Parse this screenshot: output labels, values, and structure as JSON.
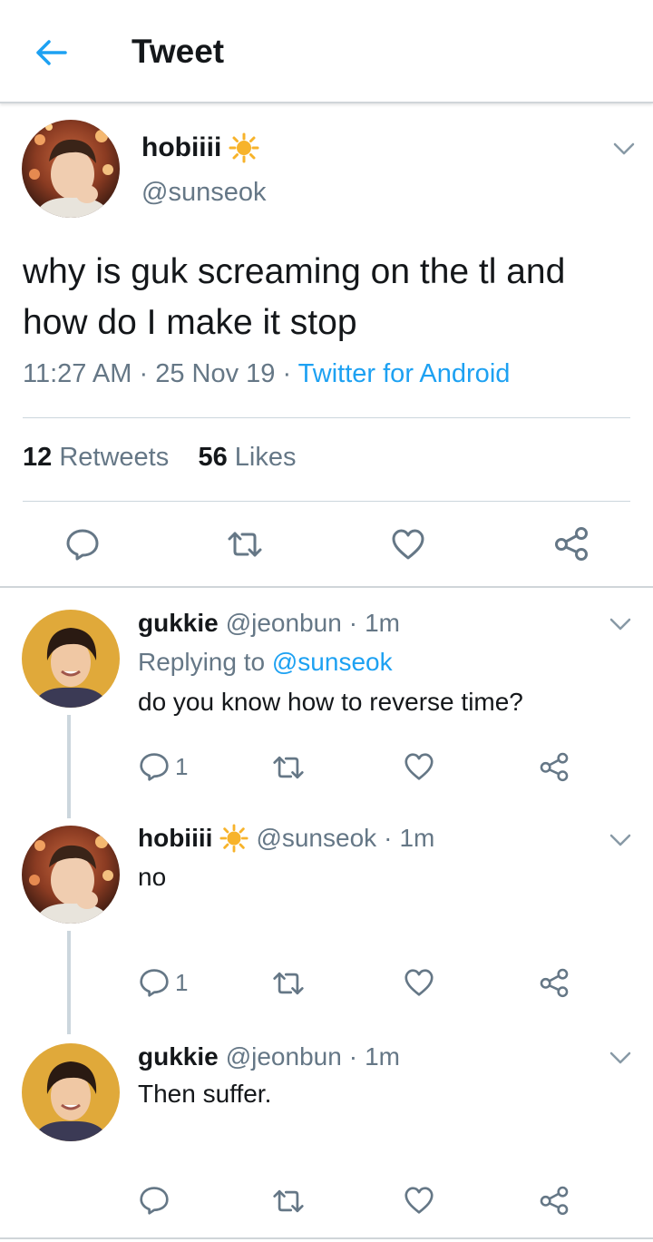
{
  "header": {
    "title": "Tweet"
  },
  "main_tweet": {
    "display_name": "hobiiii",
    "handle": "@sunseok",
    "text": "why is guk screaming on the tl and how do I make it stop",
    "time": "11:27 AM",
    "date": "25 Nov 19",
    "source": "Twitter for Android",
    "retweets_count": "12",
    "retweets_label": "Retweets",
    "likes_count": "56",
    "likes_label": "Likes"
  },
  "replies": [
    {
      "display_name": "gukkie",
      "handle": "@jeonbun",
      "time": "1m",
      "replying_prefix": "Replying to",
      "replying_handle": "@sunseok",
      "text": "do you know how to reverse time?",
      "reply_count": "1"
    },
    {
      "display_name": "hobiiii",
      "handle": "@sunseok",
      "time": "1m",
      "text": "no",
      "reply_count": "1"
    },
    {
      "display_name": "gukkie",
      "handle": "@jeonbun",
      "time": "1m",
      "text": "Then suffer."
    }
  ],
  "separator": "·",
  "colors": {
    "accent": "#1da1f2",
    "secondary_text": "#657786",
    "divider": "#ccd6dd",
    "sun_emoji": "#f7b32b"
  },
  "icons": [
    "back-arrow-icon",
    "sun-emoji-icon",
    "chevron-down-icon",
    "reply-icon",
    "retweet-icon",
    "like-icon",
    "share-icon"
  ]
}
